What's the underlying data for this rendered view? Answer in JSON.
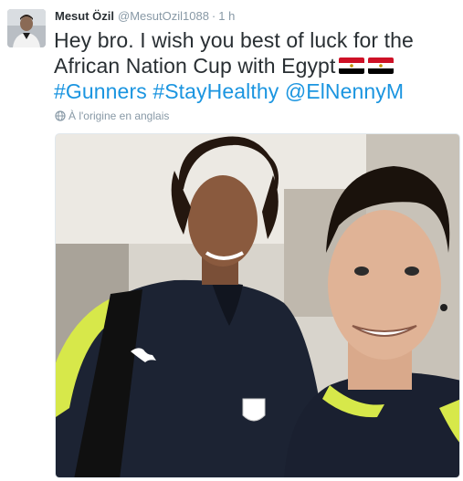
{
  "tweet": {
    "author_name": "Mesut Özil",
    "author_handle": "@MesutOzil1088",
    "separator": "·",
    "timestamp": "1 h",
    "text_plain": "Hey bro. I wish you best of luck for the African Nation Cup with Egypt",
    "hashtags": [
      "#Gunners",
      "#StayHealthy"
    ],
    "mention": "@ElNennyM",
    "flags": [
      "egypt-flag",
      "egypt-flag"
    ],
    "translation_note": "À l'origine en anglais",
    "translation_icon": "globe-icon"
  },
  "colors": {
    "link": "#1b95e0",
    "secondary_text": "#8899a6",
    "primary_text": "#292f33"
  }
}
